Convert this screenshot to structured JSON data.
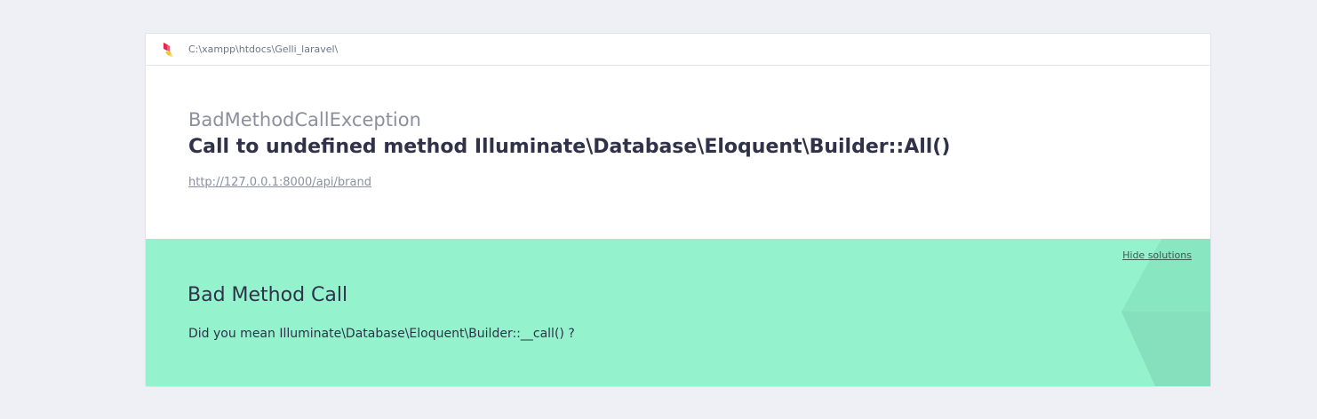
{
  "header": {
    "path": "C:\\xampp\\htdocs\\Gelli_laravel\\"
  },
  "error": {
    "exception_class": "BadMethodCallException",
    "message": "Call to undefined method Illuminate\\Database\\Eloquent\\Builder::All()",
    "url": "http://127.0.0.1:8000/api/brand"
  },
  "solution": {
    "hide_label": "Hide solutions",
    "title": "Bad Method Call",
    "description": "Did you mean Illuminate\\Database\\Eloquent\\Builder::__call() ?"
  },
  "colors": {
    "page_background": "#eef0f5",
    "solution_background": "#94f2cc",
    "logo_red": "#e8264b",
    "logo_yellow": "#f5c52b"
  },
  "icons": {
    "logo": "ignition-flame-icon"
  }
}
